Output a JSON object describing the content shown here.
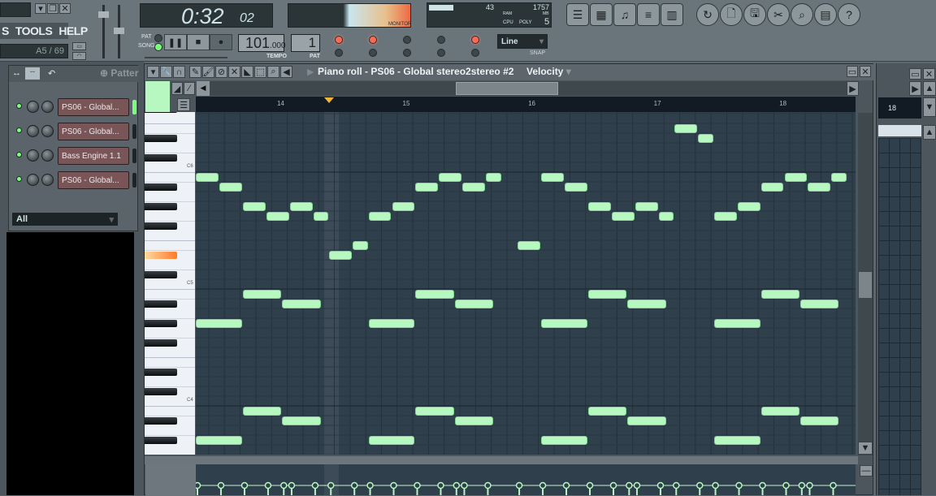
{
  "menu": {
    "items": [
      "S",
      "TOOLS",
      "HELP"
    ]
  },
  "hint": "A5 / 69",
  "transport": {
    "time": "0:32",
    "time_small": "02",
    "pat_label": "PAT",
    "song_label": "SONG",
    "mode": "SONG",
    "tempo": "101",
    "tempo_frac": ".000",
    "tempo_label": "TEMPO",
    "pattern": "1",
    "pattern_label": "PAT"
  },
  "monitor": {
    "label": "MONITOR"
  },
  "cpu": {
    "cpu_value": "43",
    "ram_value": "1757",
    "ram_label": "RAM",
    "mb_label": "MB",
    "cpu_label": "CPU",
    "poly_label": "POLY",
    "poly_value": "5"
  },
  "snap": {
    "value": "Line",
    "label": "SNAP"
  },
  "rack": {
    "pattern_label": "Patter",
    "filter": "All",
    "channels": [
      {
        "name": "PS06 - Global...",
        "active": true
      },
      {
        "name": "PS06 - Global...",
        "active": false
      },
      {
        "name": "Bass Engine 1.1",
        "active": false
      },
      {
        "name": "PS06 - Global...",
        "active": false
      }
    ]
  },
  "pianoroll": {
    "title": "Piano roll - PS06 - Global stereo2stereo #2",
    "target": "Velocity",
    "bars": [
      "14",
      "15",
      "16",
      "17",
      "18"
    ],
    "key_labels": [
      "C6",
      "C5",
      "C4"
    ],
    "highlighted_key": 63,
    "notes": [
      [
        0,
        3,
        71
      ],
      [
        3,
        3,
        70
      ],
      [
        6,
        3,
        68
      ],
      [
        9,
        3,
        67
      ],
      [
        12,
        3,
        68
      ],
      [
        15,
        2,
        67
      ],
      [
        17,
        3,
        63
      ],
      [
        20,
        2,
        64
      ],
      [
        22,
        3,
        67
      ],
      [
        25,
        3,
        68
      ],
      [
        28,
        3,
        70
      ],
      [
        31,
        3,
        71
      ],
      [
        34,
        3,
        70
      ],
      [
        37,
        2,
        71
      ],
      [
        41,
        3,
        64
      ],
      [
        44,
        3,
        71
      ],
      [
        47,
        3,
        70
      ],
      [
        50,
        3,
        68
      ],
      [
        53,
        3,
        67
      ],
      [
        56,
        3,
        68
      ],
      [
        59,
        2,
        67
      ],
      [
        61,
        3,
        76
      ],
      [
        64,
        2,
        75
      ],
      [
        66,
        3,
        67
      ],
      [
        69,
        3,
        68
      ],
      [
        72,
        3,
        70
      ],
      [
        75,
        3,
        71
      ],
      [
        78,
        3,
        70
      ],
      [
        81,
        2,
        71
      ],
      [
        6,
        5,
        59
      ],
      [
        11,
        5,
        58
      ],
      [
        0,
        6,
        56
      ],
      [
        22,
        6,
        56
      ],
      [
        28,
        5,
        59
      ],
      [
        33,
        5,
        58
      ],
      [
        50,
        5,
        59
      ],
      [
        55,
        5,
        58
      ],
      [
        44,
        6,
        56
      ],
      [
        66,
        6,
        56
      ],
      [
        72,
        5,
        59
      ],
      [
        77,
        5,
        58
      ],
      [
        6,
        5,
        47
      ],
      [
        11,
        5,
        46
      ],
      [
        0,
        6,
        44
      ],
      [
        22,
        6,
        44
      ],
      [
        28,
        5,
        47
      ],
      [
        33,
        5,
        46
      ],
      [
        50,
        5,
        47
      ],
      [
        55,
        5,
        46
      ],
      [
        44,
        6,
        44
      ],
      [
        66,
        6,
        44
      ],
      [
        72,
        5,
        47
      ],
      [
        77,
        5,
        46
      ]
    ],
    "note_color": "#b7f7c0"
  },
  "playlist": {
    "bar": "18"
  }
}
